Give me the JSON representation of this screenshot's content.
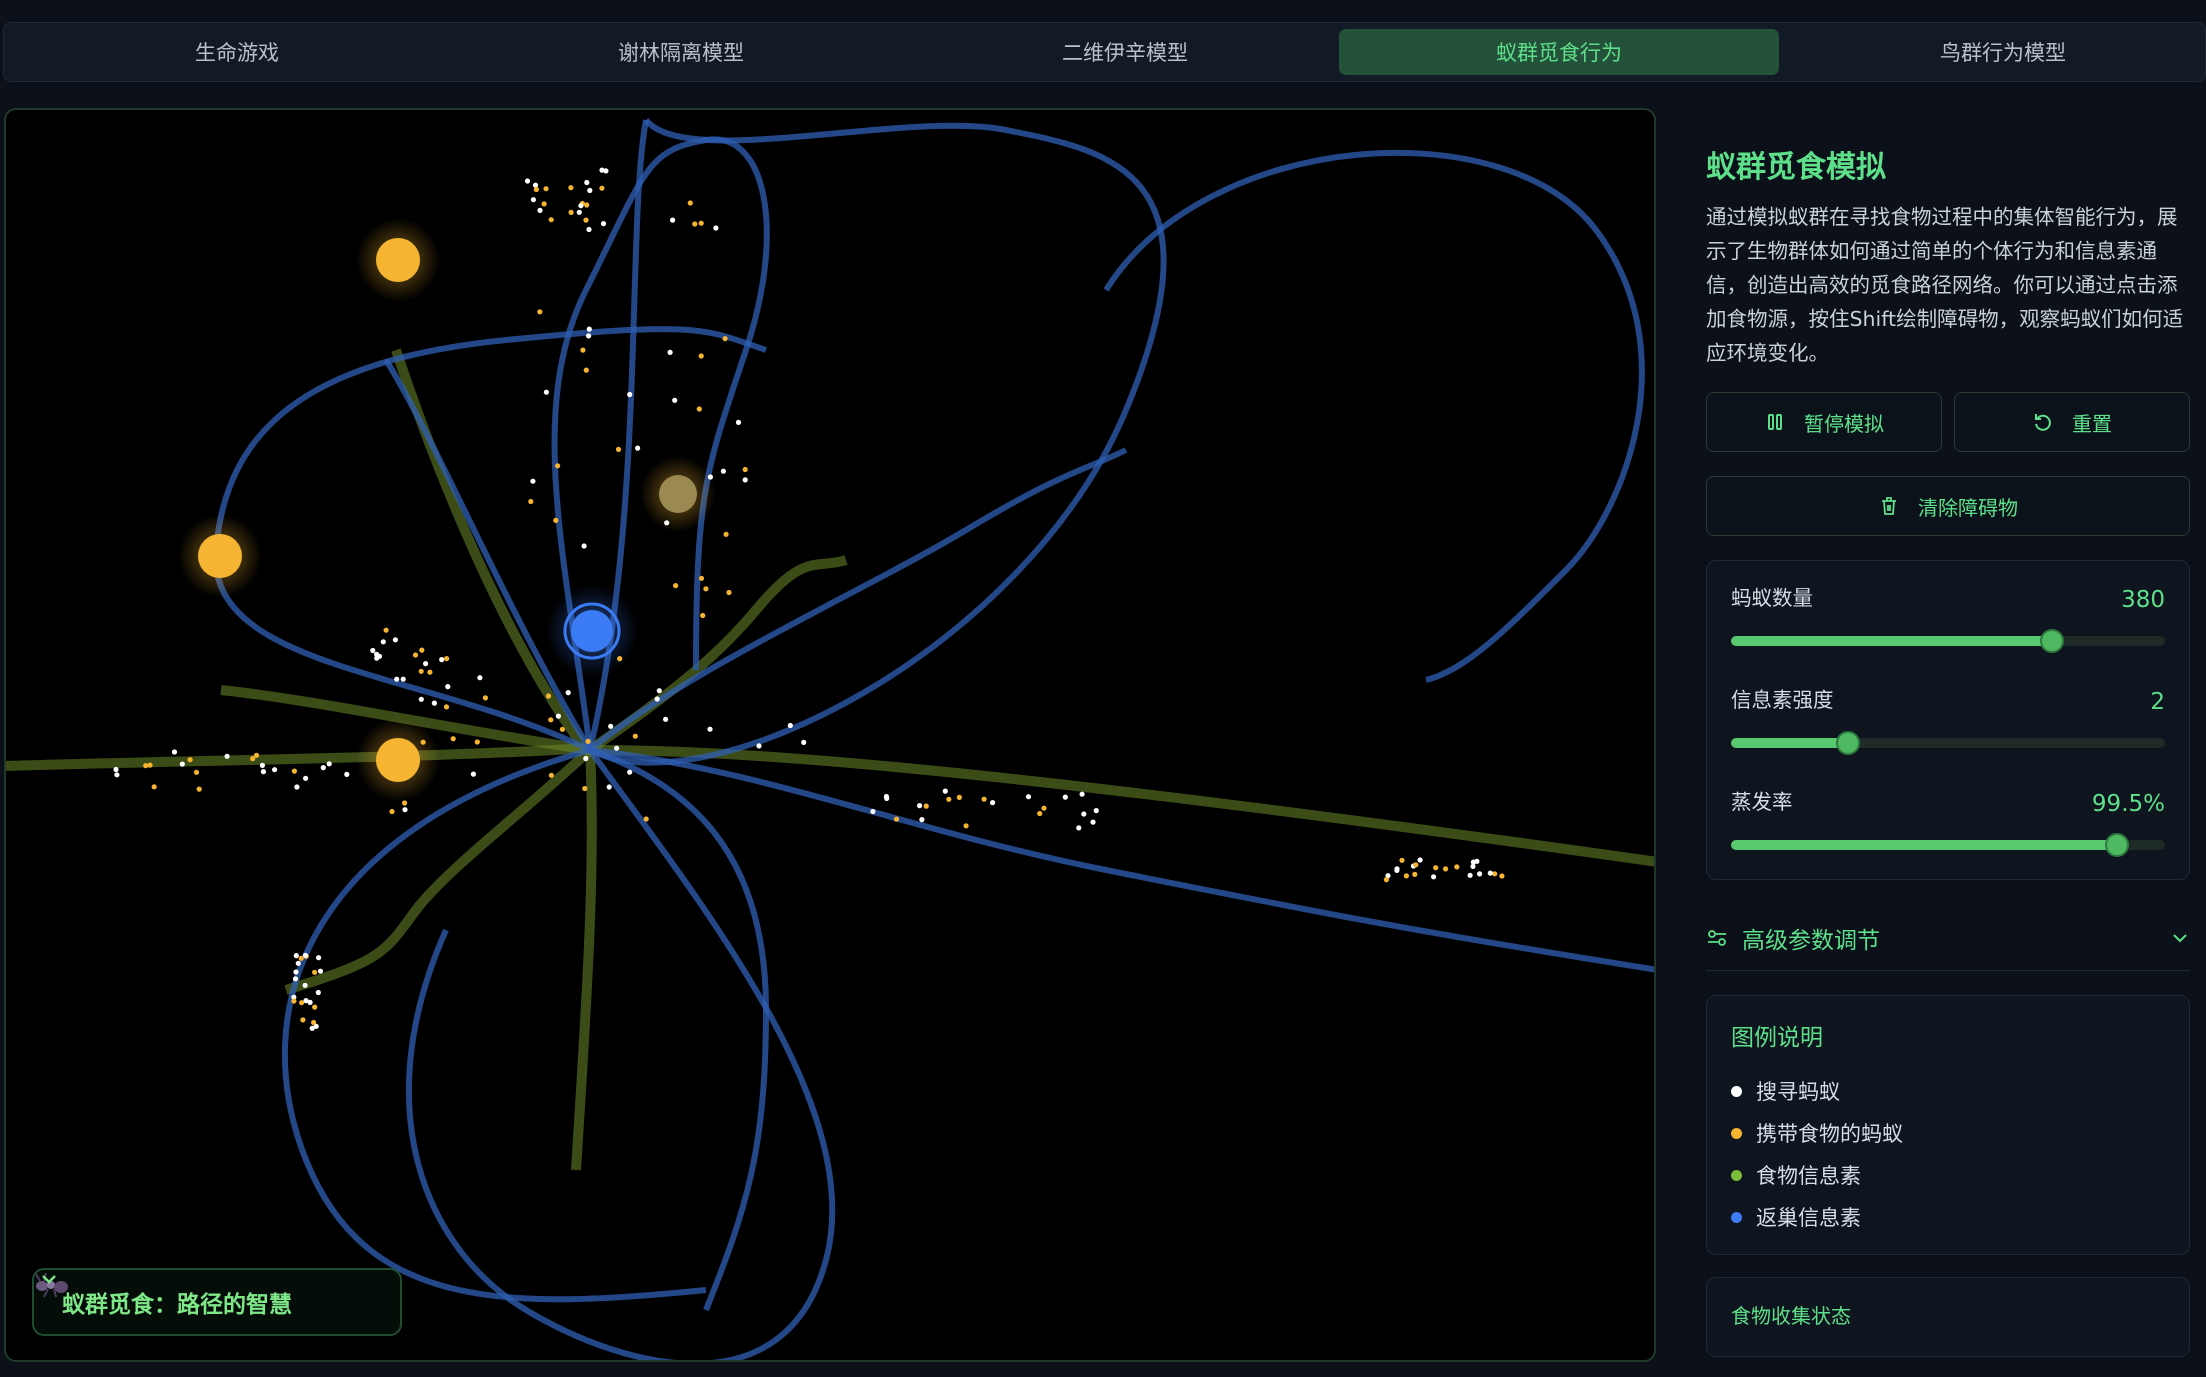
{
  "tabs": [
    {
      "label": "生命游戏"
    },
    {
      "label": "谢林隔离模型"
    },
    {
      "label": "二维伊辛模型"
    },
    {
      "label": "蚁群觅食行为"
    },
    {
      "label": "鸟群行为模型"
    }
  ],
  "active_tab": 3,
  "canvas": {
    "caption": "蚁群觅食：路径的智慧"
  },
  "panel": {
    "title": "蚁群觅食模拟",
    "description": "通过模拟蚁群在寻找食物过程中的集体智能行为，展示了生物群体如何通过简单的个体行为和信息素通信，创造出高效的觅食路径网络。你可以通过点击添加食物源，按住Shift绘制障碍物，观察蚂蚁们如何适应环境变化。",
    "pause_label": "暂停模拟",
    "reset_label": "重置",
    "clear_label": "清除障碍物",
    "sliders": [
      {
        "label": "蚂蚁数量",
        "value": "380",
        "fraction": 0.74
      },
      {
        "label": "信息素强度",
        "value": "2",
        "fraction": 0.27
      },
      {
        "label": "蒸发率",
        "value": "99.5%",
        "fraction": 0.89
      }
    ],
    "advanced_label": "高级参数调节",
    "legend": {
      "title": "图例说明",
      "items": [
        {
          "label": "搜寻蚂蚁",
          "color": "#ffffff"
        },
        {
          "label": "携带食物的蚂蚁",
          "color": "#f5b431"
        },
        {
          "label": "食物信息素",
          "color": "#7cbd3a"
        },
        {
          "label": "返巢信息素",
          "color": "#3b7cf5"
        }
      ]
    },
    "food_status_label": "食物收集状态"
  },
  "icons": {
    "pause": "pause-icon",
    "reset": "reset-icon",
    "clear": "trash-icon",
    "advanced": "sliders-icon",
    "caption": "ant-icon"
  }
}
